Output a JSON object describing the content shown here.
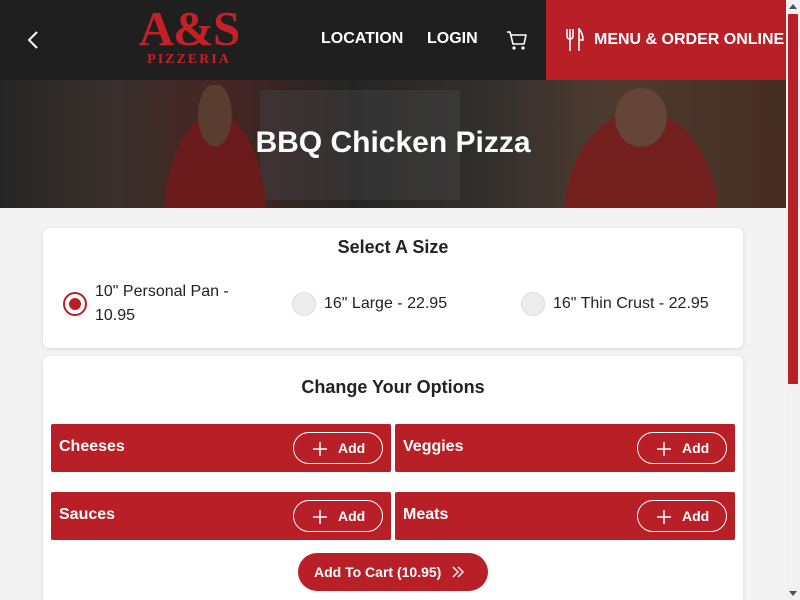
{
  "header": {
    "logo_main": "A&S",
    "logo_sub": "PIZZERIA",
    "nav": {
      "location": "LOCATION",
      "login": "LOGIN"
    },
    "menu_button": "MENU & ORDER ONLINE",
    "icons": {
      "back": "chevron-left-icon",
      "cart": "cart-icon",
      "menu": "fork-knife-icon"
    }
  },
  "hero": {
    "title": "BBQ Chicken Pizza"
  },
  "size_section": {
    "title": "Select A Size",
    "options": [
      {
        "label": "10\" Personal Pan - 10.95",
        "selected": true
      },
      {
        "label": "16\" Large - 22.95",
        "selected": false
      },
      {
        "label": "16\" Thin Crust - 22.95",
        "selected": false
      }
    ]
  },
  "options_section": {
    "title": "Change Your Options",
    "groups": [
      {
        "label": "Cheeses",
        "add": "Add"
      },
      {
        "label": "Veggies",
        "add": "Add"
      },
      {
        "label": "Sauces",
        "add": "Add"
      },
      {
        "label": "Meats",
        "add": "Add"
      }
    ],
    "add_to_cart": "Add To Cart (10.95)"
  },
  "colors": {
    "brand_red": "#b81f26",
    "header_bg": "#1f1f1f"
  }
}
